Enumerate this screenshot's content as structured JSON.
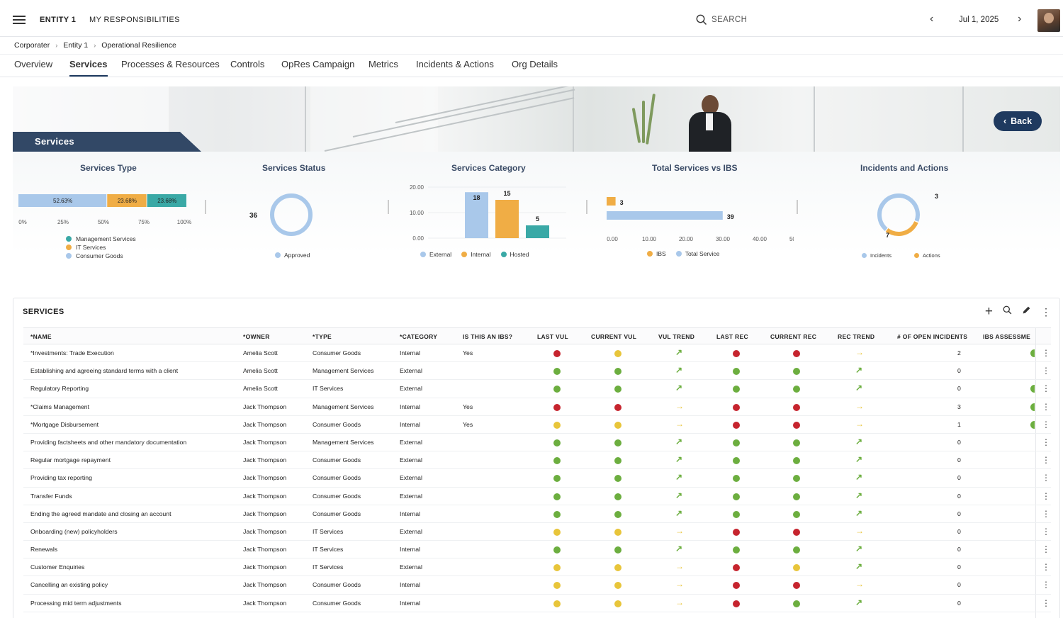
{
  "header": {
    "entity": "ENTITY 1",
    "responsibilities": "MY RESPONSIBILITIES",
    "search_placeholder": "SEARCH",
    "date": "Jul 1, 2025"
  },
  "breadcrumb": [
    "Corporater",
    "Entity 1",
    "Operational Resilience"
  ],
  "tabs": [
    "Overview",
    "Services",
    "Processes & Resources",
    "Controls",
    "OpRes Campaign",
    "Metrics",
    "Incidents & Actions",
    "Org Details"
  ],
  "active_tab": "Services",
  "hero": {
    "title": "Services",
    "back_label": "Back"
  },
  "colors": {
    "navy": "#1f3a5f",
    "green": "#6cae3f",
    "yellow": "#e8c53a",
    "red": "#c6242e",
    "orange": "#f0ad45",
    "lightblue": "#a9c8ea",
    "teal": "#3aa9a6"
  },
  "charts": {
    "services_type": {
      "title": "Services Type",
      "segments": [
        {
          "label": "52.63%",
          "value": 52.63,
          "color": "#a9c8ea"
        },
        {
          "label": "23.68%",
          "value": 23.68,
          "color": "#f0ad45"
        },
        {
          "label": "23.68%",
          "value": 23.68,
          "color": "#3aa9a6"
        }
      ],
      "ticks": [
        "0%",
        "25%",
        "50%",
        "75%",
        "100%"
      ],
      "legend": [
        {
          "label": "Management Services",
          "color": "#3aa9a6"
        },
        {
          "label": "IT Services",
          "color": "#f0ad45"
        },
        {
          "label": "Consumer Goods",
          "color": "#a9c8ea"
        }
      ]
    },
    "services_status": {
      "title": "Services Status",
      "value_label": "36",
      "legend": [
        {
          "label": "Approved",
          "color": "#a9c8ea"
        }
      ]
    },
    "services_category": {
      "title": "Services Category",
      "y_ticks": [
        "20.00",
        "10.00",
        "0.00"
      ],
      "bars": [
        {
          "label": "18",
          "value": 18,
          "color": "#a9c8ea"
        },
        {
          "label": "15",
          "value": 15,
          "color": "#f0ad45"
        },
        {
          "label": "5",
          "value": 5,
          "color": "#3aa9a6"
        }
      ],
      "legend": [
        {
          "label": "External",
          "color": "#a9c8ea"
        },
        {
          "label": "Internal",
          "color": "#f0ad45"
        },
        {
          "label": "Hosted",
          "color": "#3aa9a6"
        }
      ]
    },
    "total_vs_ibs": {
      "title": "Total Services vs IBS",
      "bars": [
        {
          "label": "3",
          "value": 3,
          "color": "#f0ad45"
        },
        {
          "label": "39",
          "value": 39,
          "color": "#a9c8ea"
        }
      ],
      "x_ticks": [
        "0.00",
        "10.00",
        "20.00",
        "30.00",
        "40.00",
        "50.00"
      ],
      "legend": [
        {
          "label": "IBS",
          "color": "#f0ad45"
        },
        {
          "label": "Total Service",
          "color": "#a9c8ea"
        }
      ]
    },
    "incidents_actions": {
      "title": "Incidents and Actions",
      "slices": [
        {
          "label": "7",
          "value": 7,
          "color": "#a9c8ea"
        },
        {
          "label": "3",
          "value": 3,
          "color": "#f0ad45"
        }
      ],
      "legend": [
        {
          "label": "Incidents",
          "color": "#a9c8ea"
        },
        {
          "label": "Actions",
          "color": "#f0ad45"
        }
      ]
    }
  },
  "table": {
    "title": "SERVICES",
    "columns": [
      "*NAME",
      "*OWNER",
      "*TYPE",
      "*CATEGORY",
      "IS THIS AN IBS?",
      "LAST VUL",
      "CURRENT VUL",
      "VUL TREND",
      "LAST REC",
      "CURRENT REC",
      "REC TREND",
      "# OF OPEN INCIDENTS",
      "IBS ASSESSME"
    ],
    "rows": [
      {
        "name": "*Investments: Trade Execution",
        "owner": "Amelia Scott",
        "type": "Consumer Goods",
        "category": "Internal",
        "ibs": "Yes",
        "last_vul": "red",
        "cur_vul": "yellow",
        "vul_trend": "up",
        "last_rec": "red",
        "cur_rec": "red",
        "rec_trend": "right",
        "incidents": "2",
        "assess": "green"
      },
      {
        "name": "Establishing and agreeing standard terms with a client",
        "owner": "Amelia Scott",
        "type": "Management Services",
        "category": "External",
        "ibs": "",
        "last_vul": "green",
        "cur_vul": "green",
        "vul_trend": "up",
        "last_rec": "green",
        "cur_rec": "green",
        "rec_trend": "up",
        "incidents": "0",
        "assess": ""
      },
      {
        "name": "Regulatory Reporting",
        "owner": "Amelia Scott",
        "type": "IT Services",
        "category": "External",
        "ibs": "",
        "last_vul": "green",
        "cur_vul": "green",
        "vul_trend": "up",
        "last_rec": "green",
        "cur_rec": "green",
        "rec_trend": "up",
        "incidents": "0",
        "assess": "green"
      },
      {
        "name": "*Claims Management",
        "owner": "Jack Thompson",
        "type": "Management Services",
        "category": "Internal",
        "ibs": "Yes",
        "last_vul": "red",
        "cur_vul": "red",
        "vul_trend": "right",
        "last_rec": "red",
        "cur_rec": "red",
        "rec_trend": "right",
        "incidents": "3",
        "assess": "green"
      },
      {
        "name": "*Mortgage Disbursement",
        "owner": "Jack Thompson",
        "type": "Consumer Goods",
        "category": "Internal",
        "ibs": "Yes",
        "last_vul": "yellow",
        "cur_vul": "yellow",
        "vul_trend": "right",
        "last_rec": "red",
        "cur_rec": "red",
        "rec_trend": "right",
        "incidents": "1",
        "assess": "green"
      },
      {
        "name": "Providing factsheets and other mandatory documentation",
        "owner": "Jack Thompson",
        "type": "Management Services",
        "category": "External",
        "ibs": "",
        "last_vul": "green",
        "cur_vul": "green",
        "vul_trend": "up",
        "last_rec": "green",
        "cur_rec": "green",
        "rec_trend": "up",
        "incidents": "0",
        "assess": ""
      },
      {
        "name": "Regular mortgage repayment",
        "owner": "Jack Thompson",
        "type": "Consumer Goods",
        "category": "External",
        "ibs": "",
        "last_vul": "green",
        "cur_vul": "green",
        "vul_trend": "up",
        "last_rec": "green",
        "cur_rec": "green",
        "rec_trend": "up",
        "incidents": "0",
        "assess": ""
      },
      {
        "name": "Providing tax reporting",
        "owner": "Jack Thompson",
        "type": "Consumer Goods",
        "category": "External",
        "ibs": "",
        "last_vul": "green",
        "cur_vul": "green",
        "vul_trend": "up",
        "last_rec": "green",
        "cur_rec": "green",
        "rec_trend": "up",
        "incidents": "0",
        "assess": ""
      },
      {
        "name": "Transfer Funds",
        "owner": "Jack Thompson",
        "type": "Consumer Goods",
        "category": "External",
        "ibs": "",
        "last_vul": "green",
        "cur_vul": "green",
        "vul_trend": "up",
        "last_rec": "green",
        "cur_rec": "green",
        "rec_trend": "up",
        "incidents": "0",
        "assess": ""
      },
      {
        "name": "Ending the agreed mandate and closing an account",
        "owner": "Jack Thompson",
        "type": "Consumer Goods",
        "category": "Internal",
        "ibs": "",
        "last_vul": "green",
        "cur_vul": "green",
        "vul_trend": "up",
        "last_rec": "green",
        "cur_rec": "green",
        "rec_trend": "up",
        "incidents": "0",
        "assess": ""
      },
      {
        "name": "Onboarding (new) policyholders",
        "owner": "Jack Thompson",
        "type": "IT Services",
        "category": "External",
        "ibs": "",
        "last_vul": "yellow",
        "cur_vul": "yellow",
        "vul_trend": "right",
        "last_rec": "red",
        "cur_rec": "red",
        "rec_trend": "right",
        "incidents": "0",
        "assess": ""
      },
      {
        "name": "Renewals",
        "owner": "Jack Thompson",
        "type": "IT Services",
        "category": "Internal",
        "ibs": "",
        "last_vul": "green",
        "cur_vul": "green",
        "vul_trend": "up",
        "last_rec": "green",
        "cur_rec": "green",
        "rec_trend": "up",
        "incidents": "0",
        "assess": ""
      },
      {
        "name": "Customer Enquiries",
        "owner": "Jack Thompson",
        "type": "IT Services",
        "category": "External",
        "ibs": "",
        "last_vul": "yellow",
        "cur_vul": "yellow",
        "vul_trend": "right",
        "last_rec": "red",
        "cur_rec": "yellow",
        "rec_trend": "up",
        "incidents": "0",
        "assess": ""
      },
      {
        "name": "Cancelling an existing policy",
        "owner": "Jack Thompson",
        "type": "Consumer Goods",
        "category": "Internal",
        "ibs": "",
        "last_vul": "yellow",
        "cur_vul": "yellow",
        "vul_trend": "right",
        "last_rec": "red",
        "cur_rec": "red",
        "rec_trend": "right",
        "incidents": "0",
        "assess": ""
      },
      {
        "name": "Processing mid term adjustments",
        "owner": "Jack Thompson",
        "type": "Consumer Goods",
        "category": "Internal",
        "ibs": "",
        "last_vul": "yellow",
        "cur_vul": "yellow",
        "vul_trend": "right",
        "last_rec": "red",
        "cur_rec": "green",
        "rec_trend": "up",
        "incidents": "0",
        "assess": ""
      }
    ]
  }
}
